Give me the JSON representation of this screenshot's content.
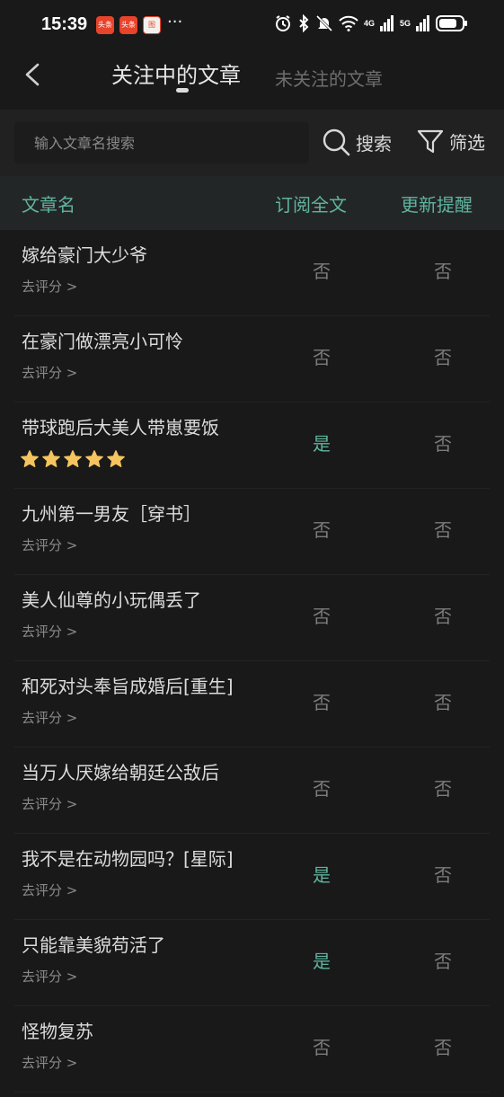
{
  "status_bar": {
    "time": "15:39",
    "badges": [
      "头条",
      "头条",
      "图"
    ],
    "more": "···",
    "net_4g": "4G",
    "net_5g": "5G"
  },
  "header": {
    "back": "<",
    "tab_following": "关注中的文章",
    "tab_not_following": "未关注的文章"
  },
  "search": {
    "placeholder": "输入文章名搜索",
    "value": "",
    "search_label": "搜索",
    "filter_label": "筛选"
  },
  "table": {
    "columns": [
      "文章名",
      "订阅全文",
      "更新提醒"
    ],
    "rows": [
      {
        "title": "嫁给豪门大少爷",
        "rate": "去评分 >",
        "rated": false,
        "subscribe": "否",
        "remind": "否"
      },
      {
        "title": "在豪门做漂亮小可怜",
        "rate": "去评分 >",
        "rated": false,
        "subscribe": "否",
        "remind": "否"
      },
      {
        "title": "带球跑后大美人带崽要饭",
        "rate": "",
        "rated": true,
        "stars": 5,
        "subscribe": "是",
        "remind": "否"
      },
      {
        "title": "九州第一男友［穿书］",
        "rate": "去评分 >",
        "rated": false,
        "subscribe": "否",
        "remind": "否"
      },
      {
        "title": "美人仙尊的小玩偶丢了",
        "rate": "去评分 >",
        "rated": false,
        "subscribe": "否",
        "remind": "否"
      },
      {
        "title": "和死对头奉旨成婚后[重生]",
        "rate": "去评分 >",
        "rated": false,
        "subscribe": "否",
        "remind": "否"
      },
      {
        "title": "当万人厌嫁给朝廷公敌后",
        "rate": "去评分 >",
        "rated": false,
        "subscribe": "否",
        "remind": "否"
      },
      {
        "title": "我不是在动物园吗？[星际]",
        "rate": "去评分 >",
        "rated": false,
        "subscribe": "是",
        "remind": "否"
      },
      {
        "title": "只能靠美貌苟活了",
        "rate": "去评分 >",
        "rated": false,
        "subscribe": "是",
        "remind": "否"
      },
      {
        "title": "怪物复苏",
        "rate": "去评分 >",
        "rated": false,
        "subscribe": "否",
        "remind": "否"
      }
    ]
  },
  "colors": {
    "accent": "#5fb4a0",
    "star": "#f5c45e",
    "background": "#191919"
  }
}
